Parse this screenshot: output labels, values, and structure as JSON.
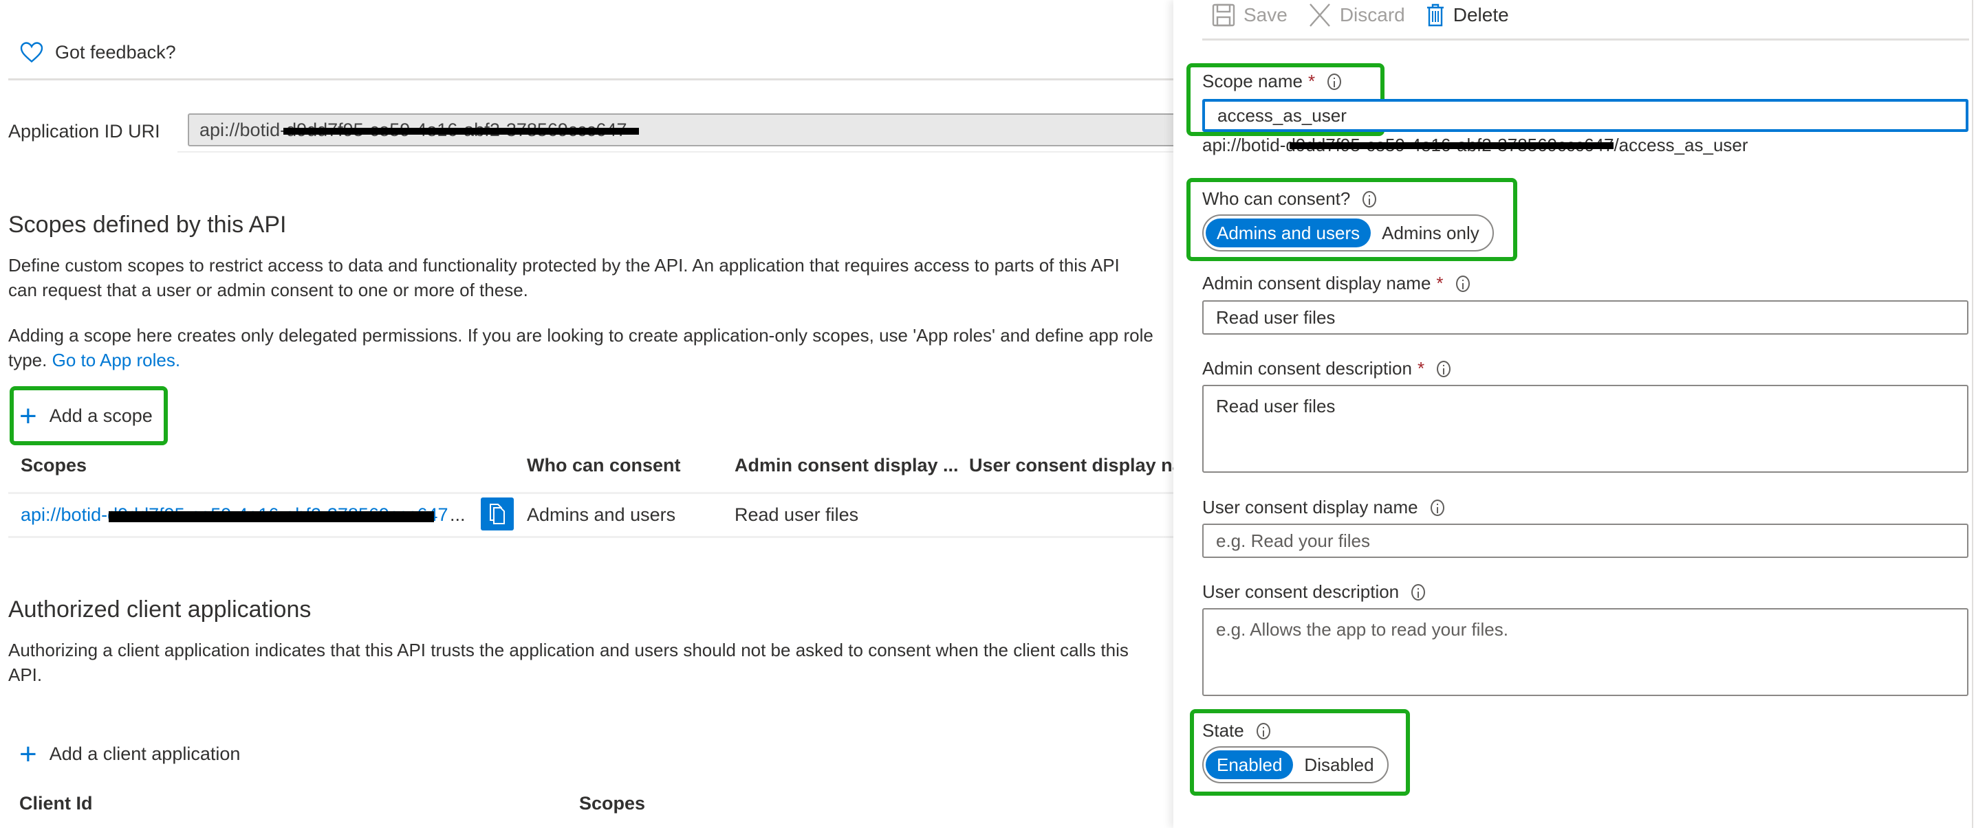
{
  "feedback": {
    "label": "Got feedback?",
    "icon": "heart-icon"
  },
  "application_id_uri": {
    "label": "Application ID URI",
    "value_prefix": "api://botid-",
    "value_redacted": "d9dd7f95-ce59-4e16-abf2-378569ccc647"
  },
  "scopes_section": {
    "title": "Scopes defined by this API",
    "description": "Define custom scopes to restrict access to data and functionality protected by the API. An application that requires access to parts of this API can request that a user or admin consent to one or more of these.",
    "note": "Adding a scope here creates only delegated permissions. If you are looking to create application-only scopes, use 'App roles' and define app role",
    "note_cont": "type.",
    "note_link": "Go to App roles.",
    "add_button": "Add a scope",
    "table": {
      "columns": [
        "Scopes",
        "Who can consent",
        "Admin consent display ...",
        "User consent display na.."
      ],
      "rows": [
        {
          "scope_prefix": "api://botid-",
          "scope_redacted": "d9dd7f95-ce59-4e16-abf2-378569ccc647",
          "scope_ellipsis": "...",
          "who_can_consent": "Admins and users",
          "admin_consent_display": "Read user files",
          "user_consent_display": ""
        }
      ]
    }
  },
  "authorized_clients": {
    "title": "Authorized client applications",
    "description": "Authorizing a client application indicates that this API trusts the application and users should not be asked to consent when the client calls this API.",
    "add_button": "Add a client application",
    "columns": [
      "Client Id",
      "Scopes"
    ]
  },
  "panel": {
    "toolbar": {
      "save": "Save",
      "discard": "Discard",
      "delete": "Delete"
    },
    "scope_name": {
      "label": "Scope name",
      "required": "*",
      "value": "access_as_user",
      "full_uri_prefix": "api://botid-",
      "full_uri_redacted": "d9dd7f95-ce59-4e16-abf2-378569ccc647",
      "full_uri_suffix": "/access_as_user"
    },
    "who_can_consent": {
      "label": "Who can consent?",
      "options": [
        "Admins and users",
        "Admins only"
      ],
      "selected": "Admins and users"
    },
    "admin_consent_display_name": {
      "label": "Admin consent display name",
      "required": "*",
      "value": "Read user files"
    },
    "admin_consent_description": {
      "label": "Admin consent description",
      "required": "*",
      "value": "Read user files"
    },
    "user_consent_display_name": {
      "label": "User consent display name",
      "value": "",
      "placeholder": "e.g. Read your files"
    },
    "user_consent_description": {
      "label": "User consent description",
      "value": "",
      "placeholder": "e.g. Allows the app to read your files."
    },
    "state": {
      "label": "State",
      "options": [
        "Enabled",
        "Disabled"
      ],
      "selected": "Enabled"
    }
  },
  "colors": {
    "accent": "#0078d4",
    "highlight_box": "#1aaa1a",
    "required": "#a4262c"
  }
}
